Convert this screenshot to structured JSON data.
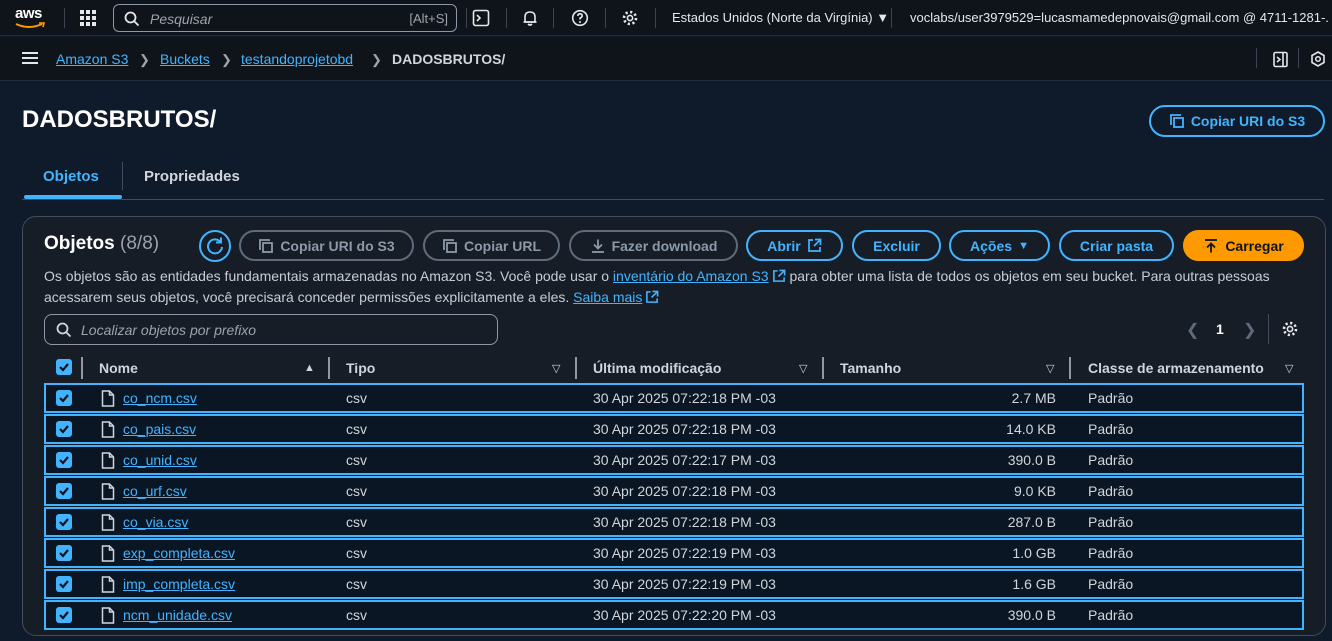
{
  "topnav": {
    "logo_text": "aws",
    "search_placeholder": "Pesquisar",
    "search_shortcut": "[Alt+S]",
    "region": "Estados Unidos (Norte da Virgínia) ▼",
    "account": "voclabs/user3979529=lucasmamedepnovais@gmail.com @ 4711-1281-..."
  },
  "breadcrumb": [
    "Amazon S3",
    "Buckets",
    "testandoprojetobd",
    "DADOSBRUTOS/"
  ],
  "page": {
    "title": "DADOSBRUTOS/",
    "copy_uri_label": "Copiar URI do S3"
  },
  "tabs": [
    "Objetos",
    "Propriedades"
  ],
  "objects": {
    "title": "Objetos",
    "count": "(8/8)",
    "buttons": {
      "copy_uri": "Copiar URI do S3",
      "copy_url": "Copiar URL",
      "download": "Fazer download",
      "open": "Abrir",
      "delete": "Excluir",
      "actions": "Ações",
      "create_folder": "Criar pasta",
      "upload": "Carregar"
    },
    "desc_before": "Os objetos são as entidades fundamentais armazenadas no Amazon S3. Você pode usar o ",
    "desc_link1": "inventário do Amazon S3",
    "desc_middle": " para obter uma lista de todos os objetos em seu bucket. Para outras pessoas acessarem seus objetos, você precisará conceder permissões explicitamente a eles. ",
    "desc_link2": "Saiba mais",
    "filter_placeholder": "Localizar objetos por prefixo",
    "page_number": "1"
  },
  "table": {
    "columns": [
      "Nome",
      "Tipo",
      "Última modificação",
      "Tamanho",
      "Classe de armazenamento"
    ],
    "rows": [
      {
        "name": "co_ncm.csv",
        "type": "csv",
        "modified": "30 Apr 2025 07:22:18 PM -03",
        "size": "2.7 MB",
        "class": "Padrão"
      },
      {
        "name": "co_pais.csv",
        "type": "csv",
        "modified": "30 Apr 2025 07:22:18 PM -03",
        "size": "14.0 KB",
        "class": "Padrão"
      },
      {
        "name": "co_unid.csv",
        "type": "csv",
        "modified": "30 Apr 2025 07:22:17 PM -03",
        "size": "390.0 B",
        "class": "Padrão"
      },
      {
        "name": "co_urf.csv",
        "type": "csv",
        "modified": "30 Apr 2025 07:22:18 PM -03",
        "size": "9.0 KB",
        "class": "Padrão"
      },
      {
        "name": "co_via.csv",
        "type": "csv",
        "modified": "30 Apr 2025 07:22:18 PM -03",
        "size": "287.0 B",
        "class": "Padrão"
      },
      {
        "name": "exp_completa.csv",
        "type": "csv",
        "modified": "30 Apr 2025 07:22:19 PM -03",
        "size": "1.0 GB",
        "class": "Padrão"
      },
      {
        "name": "imp_completa.csv",
        "type": "csv",
        "modified": "30 Apr 2025 07:22:19 PM -03",
        "size": "1.6 GB",
        "class": "Padrão"
      },
      {
        "name": "ncm_unidade.csv",
        "type": "csv",
        "modified": "30 Apr 2025 07:22:20 PM -03",
        "size": "390.0 B",
        "class": "Padrão"
      }
    ]
  },
  "colors": {
    "accent": "#42b4ff",
    "primary": "#ff9900",
    "background": "#0f1b2a"
  }
}
